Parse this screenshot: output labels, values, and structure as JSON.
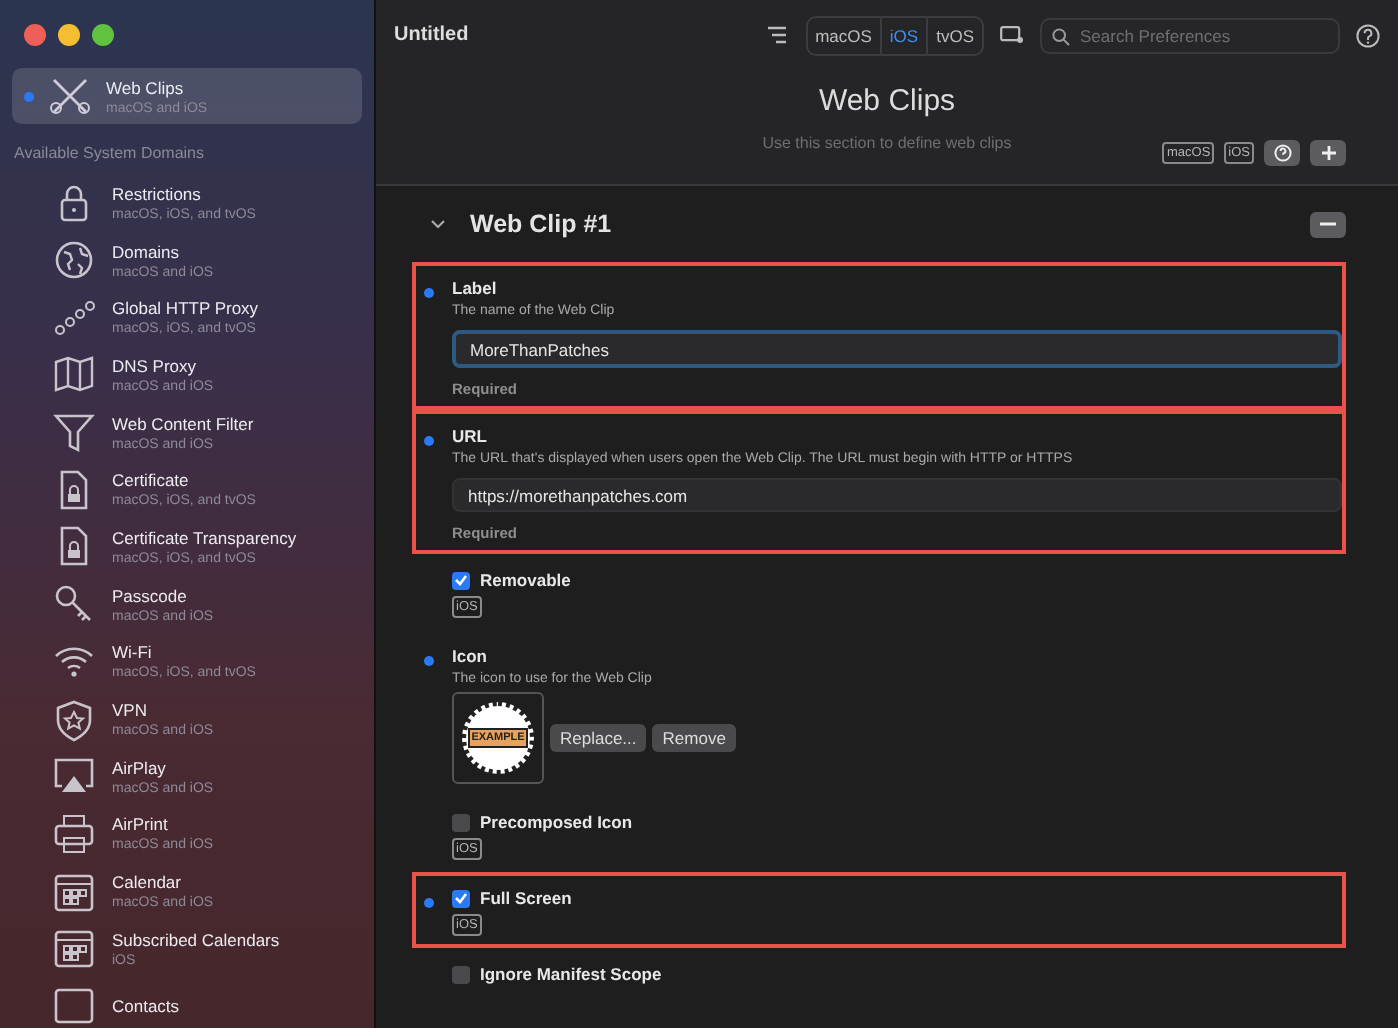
{
  "window": {
    "title": "Untitled"
  },
  "sidebar": {
    "current": {
      "name": "Web Clips",
      "platforms": "macOS and iOS",
      "selected": true,
      "configured": true
    },
    "section_title": "Available System Domains",
    "items": [
      {
        "name": "Restrictions",
        "platforms": "macOS, iOS, and tvOS"
      },
      {
        "name": "Domains",
        "platforms": "macOS and iOS"
      },
      {
        "name": "Global HTTP Proxy",
        "platforms": "macOS, iOS, and tvOS"
      },
      {
        "name": "DNS Proxy",
        "platforms": "macOS and iOS"
      },
      {
        "name": "Web Content Filter",
        "platforms": "macOS and iOS"
      },
      {
        "name": "Certificate",
        "platforms": "macOS, iOS, and tvOS"
      },
      {
        "name": "Certificate Transparency",
        "platforms": "macOS, iOS, and tvOS"
      },
      {
        "name": "Passcode",
        "platforms": "macOS and iOS"
      },
      {
        "name": "Wi-Fi",
        "platforms": "macOS, iOS, and tvOS"
      },
      {
        "name": "VPN",
        "platforms": "macOS and iOS"
      },
      {
        "name": "AirPlay",
        "platforms": "macOS and iOS"
      },
      {
        "name": "AirPrint",
        "platforms": "macOS and iOS"
      },
      {
        "name": "Calendar",
        "platforms": "macOS and iOS"
      },
      {
        "name": "Subscribed Calendars",
        "platforms": "iOS"
      },
      {
        "name": "Contacts"
      }
    ]
  },
  "toolbar": {
    "platforms": [
      {
        "label": "macOS",
        "selected": false
      },
      {
        "label": "iOS",
        "selected": true
      },
      {
        "label": "tvOS",
        "selected": false
      }
    ],
    "search": {
      "placeholder": "Search Preferences"
    }
  },
  "header": {
    "title": "Web Clips",
    "subtitle": "Use this section to define web clips",
    "tags": [
      "macOS",
      "iOS"
    ]
  },
  "section": {
    "title": "Web Clip #1",
    "expanded": true,
    "fields": [
      {
        "kind": "text",
        "configured": true,
        "highlighted": true,
        "focused": true,
        "label": "Label",
        "description": "The name of the Web Clip",
        "value": "MoreThanPatches",
        "note": "Required"
      },
      {
        "kind": "text",
        "configured": true,
        "highlighted": true,
        "focused": false,
        "label": "URL",
        "description": "The URL that's displayed when users open the Web Clip. The URL must begin with HTTP or HTTPS",
        "value": "https://morethanpatches.com",
        "note": "Required"
      },
      {
        "kind": "checkbox",
        "configured": false,
        "highlighted": false,
        "checked": true,
        "label": "Removable",
        "tags": [
          "iOS"
        ]
      },
      {
        "kind": "image",
        "configured": true,
        "highlighted": false,
        "label": "Icon",
        "description": "The icon to use for the Web Clip",
        "image_text": "EXAMPLE",
        "buttons": [
          "Replace...",
          "Remove"
        ]
      },
      {
        "kind": "checkbox",
        "configured": false,
        "highlighted": false,
        "checked": false,
        "label": "Precomposed Icon",
        "tags": [
          "iOS"
        ]
      },
      {
        "kind": "checkbox",
        "configured": true,
        "highlighted": true,
        "checked": true,
        "label": "Full Screen",
        "tags": [
          "iOS"
        ]
      },
      {
        "kind": "checkbox",
        "configured": false,
        "highlighted": false,
        "checked": false,
        "label": "Ignore Manifest Scope"
      }
    ]
  }
}
